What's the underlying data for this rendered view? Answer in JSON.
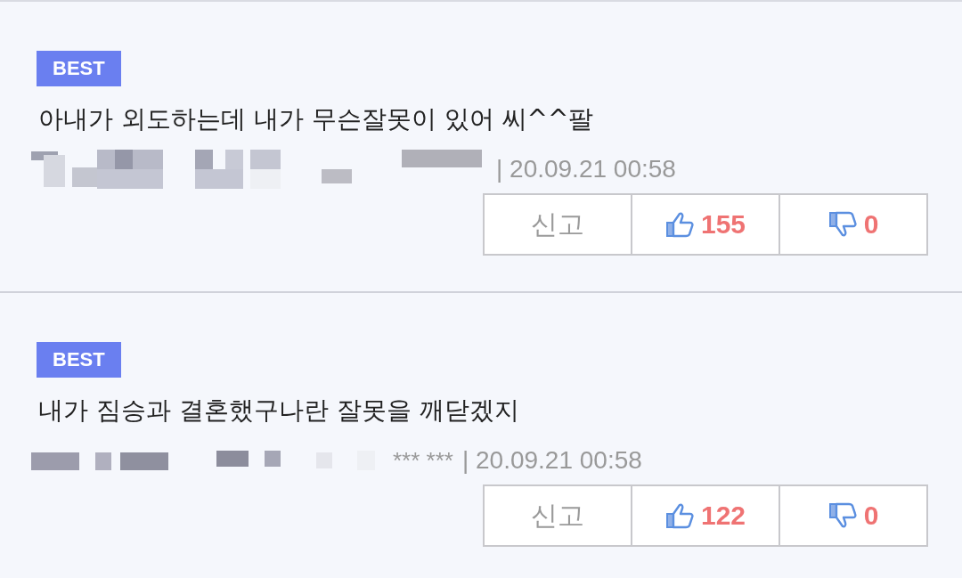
{
  "comments": [
    {
      "badge": "BEST",
      "text": "아내가 외도하는데 내가 무슨잘못이 있어 씨^^팔",
      "date": "| 20.09.21 00:58",
      "report": "신고",
      "likes": "155",
      "dislikes": "0"
    },
    {
      "badge": "BEST",
      "text": "내가 짐승과 결혼했구나란 잘못을 깨닫겠지",
      "author_visible": "*** ***",
      "date": "| 20.09.21 00:58",
      "report": "신고",
      "likes": "122",
      "dislikes": "0"
    }
  ]
}
